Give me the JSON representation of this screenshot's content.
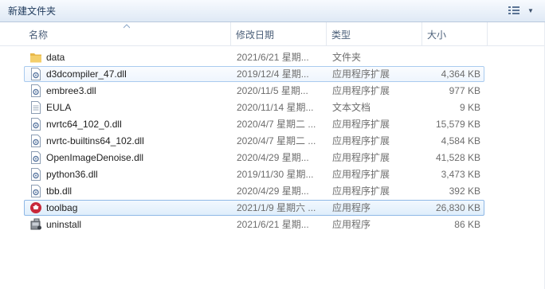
{
  "toolbar": {
    "new_folder_label": "新建文件夹",
    "views_icon": "views-icon"
  },
  "columns": {
    "name": "名称",
    "date": "修改日期",
    "type": "类型",
    "size": "大小"
  },
  "files": [
    {
      "name": "data",
      "date": "2021/6/21 星期...",
      "type": "文件夹",
      "size": "",
      "icon": "folder-icon"
    },
    {
      "name": "d3dcompiler_47.dll",
      "date": "2019/12/4 星期...",
      "type": "应用程序扩展",
      "size": "4,364 KB",
      "icon": "dll-icon"
    },
    {
      "name": "embree3.dll",
      "date": "2020/11/5 星期...",
      "type": "应用程序扩展",
      "size": "977 KB",
      "icon": "dll-icon"
    },
    {
      "name": "EULA",
      "date": "2020/11/14 星期...",
      "type": "文本文档",
      "size": "9 KB",
      "icon": "text-file-icon"
    },
    {
      "name": "nvrtc64_102_0.dll",
      "date": "2020/4/7 星期二 ...",
      "type": "应用程序扩展",
      "size": "15,579 KB",
      "icon": "dll-icon"
    },
    {
      "name": "nvrtc-builtins64_102.dll",
      "date": "2020/4/7 星期二 ...",
      "type": "应用程序扩展",
      "size": "4,584 KB",
      "icon": "dll-icon"
    },
    {
      "name": "OpenImageDenoise.dll",
      "date": "2020/4/29 星期...",
      "type": "应用程序扩展",
      "size": "41,528 KB",
      "icon": "dll-icon"
    },
    {
      "name": "python36.dll",
      "date": "2019/11/30 星期...",
      "type": "应用程序扩展",
      "size": "3,473 KB",
      "icon": "dll-icon"
    },
    {
      "name": "tbb.dll",
      "date": "2020/4/29 星期...",
      "type": "应用程序扩展",
      "size": "392 KB",
      "icon": "dll-icon"
    },
    {
      "name": "toolbag",
      "date": "2021/1/9 星期六 ...",
      "type": "应用程序",
      "size": "26,830 KB",
      "icon": "toolbag-app-icon"
    },
    {
      "name": "uninstall",
      "date": "2021/6/21 星期...",
      "type": "应用程序",
      "size": "86 KB",
      "icon": "uninstall-app-icon"
    }
  ]
}
